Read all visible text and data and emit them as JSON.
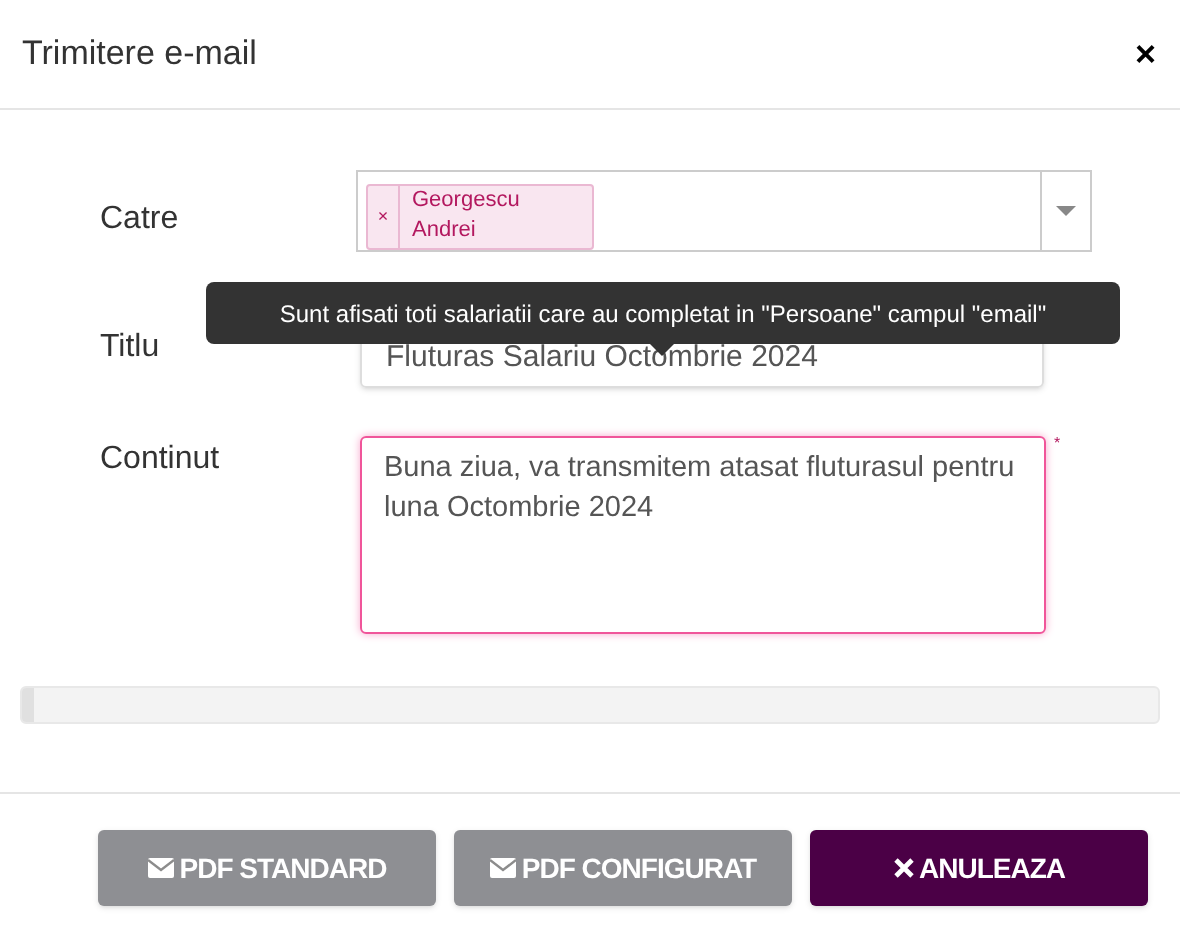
{
  "window": {
    "title": "Trimitere e-mail",
    "close": "×"
  },
  "fields": [
    {
      "kind": "select",
      "label": "Catre",
      "tags": [
        {
          "remove": "×",
          "text": "Georgescu Andrei"
        }
      ]
    },
    {
      "kind": "text",
      "label": "Titlu",
      "value": "Fluturas Salariu Octombrie 2024"
    },
    {
      "kind": "textarea",
      "label": "Continut",
      "value": "Buna ziua, va transmitem atasat fluturasul pentru luna Octombrie 2024",
      "required": "*"
    }
  ],
  "tooltip": "Sunt afisati toti salariatii care au completat in \"Persoane\" campul \"email\"",
  "progress": {
    "level": 0.01
  },
  "buttons": [
    {
      "kind": "secondary",
      "label": "PDF STANDARD"
    },
    {
      "kind": "secondary",
      "label": "PDF CONFIGURAT"
    },
    {
      "kind": "primary",
      "label": "ANULEAZA"
    }
  ]
}
